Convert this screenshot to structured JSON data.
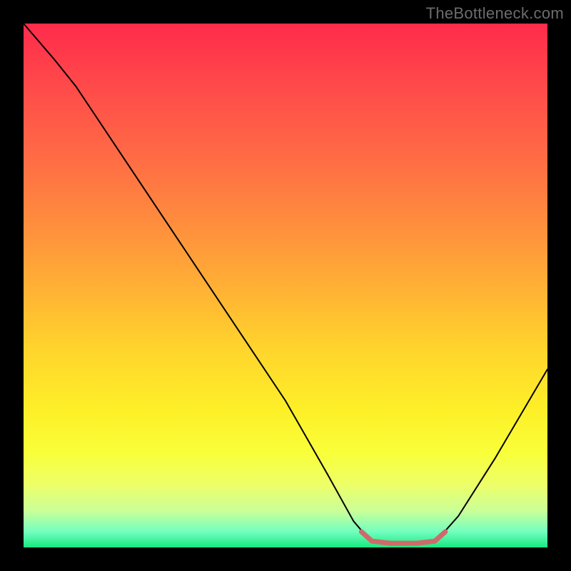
{
  "watermark": {
    "text": "TheBottleneck.com"
  },
  "chart_data": {
    "type": "line",
    "title": "",
    "xlabel": "",
    "ylabel": "",
    "xlim": [
      0,
      100
    ],
    "ylim": [
      0,
      100
    ],
    "grid": false,
    "curve": {
      "name": "bottleneck-curve",
      "color": "#000000",
      "stroke_width": 2,
      "points": [
        {
          "x": 0,
          "y": 100
        },
        {
          "x": 6,
          "y": 93
        },
        {
          "x": 10,
          "y": 88
        },
        {
          "x": 20,
          "y": 73
        },
        {
          "x": 30,
          "y": 58
        },
        {
          "x": 40,
          "y": 43
        },
        {
          "x": 50,
          "y": 28
        },
        {
          "x": 58,
          "y": 14
        },
        {
          "x": 63,
          "y": 5
        },
        {
          "x": 66,
          "y": 1.5
        },
        {
          "x": 70,
          "y": 0.8
        },
        {
          "x": 75,
          "y": 0.8
        },
        {
          "x": 79,
          "y": 1.5
        },
        {
          "x": 83,
          "y": 6
        },
        {
          "x": 90,
          "y": 17
        },
        {
          "x": 100,
          "y": 34
        }
      ]
    },
    "bottom_highlight": {
      "name": "optimal-range-marker",
      "color": "#cf6a6b",
      "stroke_width": 7,
      "points": [
        {
          "x": 64.5,
          "y": 3.0
        },
        {
          "x": 66.5,
          "y": 1.2
        },
        {
          "x": 70.0,
          "y": 0.8
        },
        {
          "x": 75.0,
          "y": 0.8
        },
        {
          "x": 78.5,
          "y": 1.2
        },
        {
          "x": 80.5,
          "y": 3.0
        }
      ]
    }
  }
}
